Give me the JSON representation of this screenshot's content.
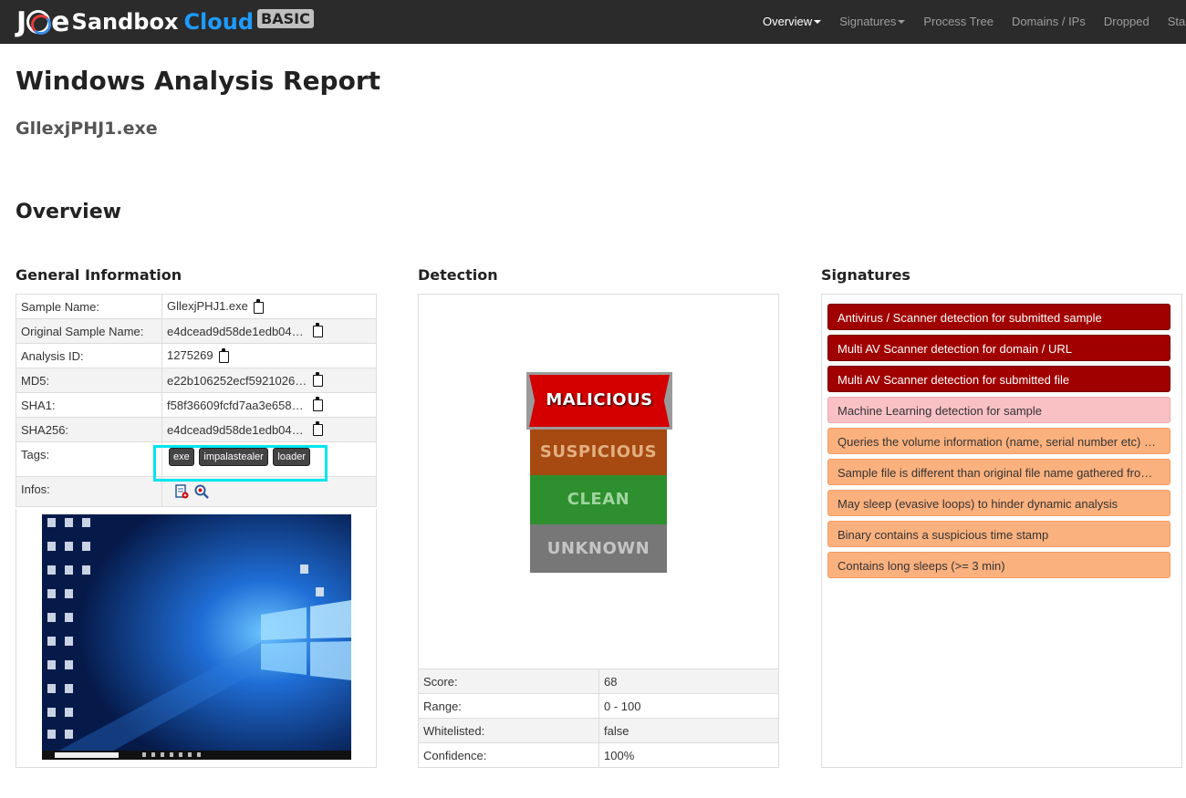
{
  "brand": {
    "name_prefix": "J",
    "name_suffix": "e",
    "name_mid": "Sandbox",
    "cloud": "Cloud",
    "edition": "BASIC"
  },
  "nav": {
    "items": [
      {
        "label": "Overview",
        "active": true,
        "dropdown": true
      },
      {
        "label": "Signatures",
        "active": false,
        "dropdown": true
      },
      {
        "label": "Process Tree",
        "active": false,
        "dropdown": false
      },
      {
        "label": "Domains / IPs",
        "active": false,
        "dropdown": false
      },
      {
        "label": "Dropped",
        "active": false,
        "dropdown": false
      },
      {
        "label": "Sta",
        "active": false,
        "dropdown": false
      }
    ]
  },
  "report": {
    "title": "Windows Analysis Report",
    "sample": "GllexjPHJ1.exe",
    "overview_heading": "Overview"
  },
  "general": {
    "heading": "General Information",
    "rows": [
      {
        "label": "Sample Name:",
        "value": "GllexjPHJ1.exe"
      },
      {
        "label": "Original Sample Name:",
        "value": "e4dcead9d58de1edb04…"
      },
      {
        "label": "Analysis ID:",
        "value": "1275269"
      },
      {
        "label": "MD5:",
        "value": "e22b106252ecf5921026…"
      },
      {
        "label": "SHA1:",
        "value": "f58f36609fcfd7aa3e658…"
      },
      {
        "label": "SHA256:",
        "value": "e4dcead9d58de1edb04…"
      }
    ],
    "tags_label": "Tags:",
    "tags": [
      "exe",
      "impalastealer",
      "loader"
    ],
    "infos_label": "Infos:"
  },
  "detection": {
    "heading": "Detection",
    "levels": {
      "malicious": "MALICIOUS",
      "suspicious": "SUSPICIOUS",
      "clean": "CLEAN",
      "unknown": "UNKNOWN"
    },
    "active_level": "malicious",
    "rows": [
      {
        "label": "Score:",
        "value": "68"
      },
      {
        "label": "Range:",
        "value": "0 - 100"
      },
      {
        "label": "Whitelisted:",
        "value": "false"
      },
      {
        "label": "Confidence:",
        "value": "100%"
      }
    ]
  },
  "signatures": {
    "heading": "Signatures",
    "items": [
      {
        "label": "Antivirus / Scanner detection for submitted sample",
        "severity": "high"
      },
      {
        "label": "Multi AV Scanner detection for domain / URL",
        "severity": "high"
      },
      {
        "label": "Multi AV Scanner detection for submitted file",
        "severity": "high"
      },
      {
        "label": "Machine Learning detection for sample",
        "severity": "med"
      },
      {
        "label": "Queries the volume information (name, serial number etc) of a device",
        "severity": "low"
      },
      {
        "label": "Sample file is different than original file name gathered from version info",
        "severity": "low"
      },
      {
        "label": "May sleep (evasive loops) to hinder dynamic analysis",
        "severity": "low"
      },
      {
        "label": "Binary contains a suspicious time stamp",
        "severity": "low"
      },
      {
        "label": "Contains long sleeps (>= 3 min)",
        "severity": "low"
      }
    ]
  },
  "colors": {
    "navbar": "#2b2b2b",
    "sig_high": "#a00000",
    "sig_med": "#f9c1c4",
    "sig_low": "#fbb17e",
    "tag_highlight": "#00e5ee"
  }
}
